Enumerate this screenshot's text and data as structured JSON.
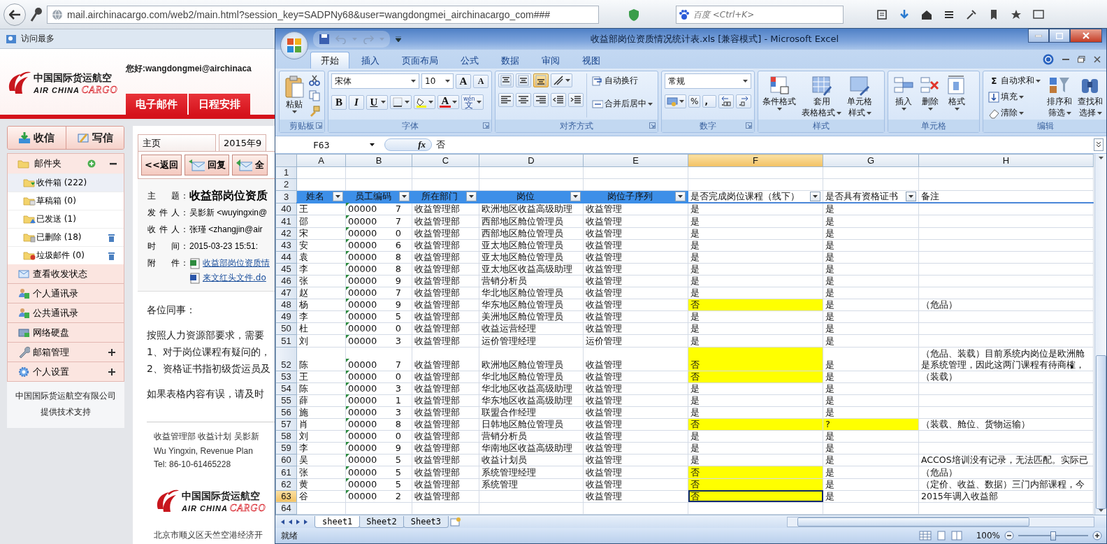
{
  "browser": {
    "url": "mail.airchinacargo.com/web2/main.html?session_key=SADPNy68&user=wangdongmei_airchinacargo_com###",
    "search_placeholder": "百度 <Ctrl+K>",
    "bookmarks": [
      "访问最多"
    ]
  },
  "mail": {
    "logo": {
      "name": "中国国际货运航空",
      "en": "AIR CHINA",
      "en_accent": "CARGO"
    },
    "greeting": "您好:wangdongmei@airchinaca",
    "nav": [
      "电子邮件",
      "日程安排"
    ],
    "actions": [
      {
        "label": "收信",
        "kind": "receive"
      },
      {
        "label": "写信",
        "kind": "compose"
      }
    ],
    "folders_title": "邮件夹",
    "folders": [
      {
        "label": "收件箱",
        "count": "(222)",
        "kind": "inbox",
        "selected": true
      },
      {
        "label": "草稿箱",
        "count": "(0)",
        "kind": "drafts",
        "selected": false
      },
      {
        "label": "已发送",
        "count": "(1)",
        "kind": "sent",
        "selected": false
      },
      {
        "label": "已删除",
        "count": "(18)",
        "kind": "deleted",
        "selected": false
      },
      {
        "label": "垃圾邮件",
        "count": "(0)",
        "kind": "spam",
        "selected": false
      }
    ],
    "menu": [
      {
        "label": "查看收发状态",
        "kind": "status",
        "expandable": false
      },
      {
        "label": "个人通讯录",
        "kind": "contacts",
        "expandable": false
      },
      {
        "label": "公共通讯录",
        "kind": "contacts",
        "expandable": false
      },
      {
        "label": "网络硬盘",
        "kind": "disk",
        "expandable": false
      },
      {
        "label": "邮箱管理",
        "kind": "admin",
        "expandable": true
      },
      {
        "label": "个人设置",
        "kind": "settings",
        "expandable": true
      }
    ],
    "footer": [
      "中国国际货运航空有限公司",
      "提供技术支持"
    ],
    "tabs": [
      "主页",
      "2015年9"
    ],
    "toolbar": [
      {
        "label": "<<返回",
        "kind": "back"
      },
      {
        "label": "回复",
        "kind": "reply"
      },
      {
        "label": "全",
        "kind": "reply_all"
      }
    ],
    "headers": [
      {
        "label": "主 题",
        "separator": "：",
        "value": "收益部岗位资质",
        "kind": "subject"
      },
      {
        "label": "发件人",
        "separator": "：",
        "value": "吴影新 <wuyingxin@",
        "kind": "plain"
      },
      {
        "label": "收件人",
        "separator": "：",
        "value": "张瑾 <zhangjin@air",
        "kind": "plain"
      },
      {
        "label": "时 间",
        "separator": "：",
        "value": "2015-03-23 15:51:",
        "kind": "plain"
      }
    ],
    "attachments_label": "附 件",
    "attachments_separator": "：",
    "attachments": [
      {
        "name": "收益部岗位资质情",
        "kind": "excel"
      },
      {
        "name": "来文红头文件.do",
        "kind": "word"
      }
    ],
    "body": [
      [
        "各位同事："
      ],
      [
        "按照人力资源部要求，需要",
        "1、对于岗位课程有疑问的，",
        "2、资格证书指初级货运员及"
      ],
      [
        "如果表格内容有误，请及时"
      ]
    ],
    "signature": [
      "收益管理部 收益计划 吴影新",
      "Wu Yingxin,  Revenue Plan",
      "Tel: 86-10-61465228"
    ],
    "signature_logo": {
      "name": "中国国际货运航空",
      "en": "AIR CHINA",
      "en_accent": "CARGO"
    },
    "address": "北京市顺义区天竺空港经济开"
  },
  "excel": {
    "title": "收益部岗位资质情况统计表.xls  [兼容模式] - Microsoft Excel",
    "tabs": [
      {
        "label": "开始",
        "selected": true
      },
      {
        "label": "插入",
        "selected": false
      },
      {
        "label": "页面布局",
        "selected": false
      },
      {
        "label": "公式",
        "selected": false
      },
      {
        "label": "数据",
        "selected": false
      },
      {
        "label": "审阅",
        "selected": false
      },
      {
        "label": "视图",
        "selected": false
      }
    ],
    "ribbon": [
      {
        "kind": "clipboard",
        "label": "剪贴板",
        "paste": "粘贴"
      },
      {
        "kind": "font",
        "label": "字体",
        "font": "宋体",
        "size": "10",
        "grow": "A",
        "shrink": "A",
        "bold": "B",
        "italic": "I",
        "underline": "U",
        "font_color_glyph": "A",
        "phonetic": "文",
        "phonetic_ruby": "wén"
      },
      {
        "kind": "alignment",
        "label": "对齐方式",
        "valign": [
          {
            "kind": "top",
            "selected": false
          },
          {
            "kind": "middle",
            "selected": false
          },
          {
            "kind": "bottom",
            "selected": true
          }
        ],
        "wrap": "自动换行",
        "merge": "合并后居中"
      },
      {
        "kind": "number",
        "label": "数字",
        "format": "常规",
        "percent": "%",
        "comma": ","
      },
      {
        "kind": "styles",
        "label": "样式",
        "buttons": [
          {
            "lines": [
              "条件格式"
            ],
            "kind": "conditional"
          },
          {
            "lines": [
              "套用",
              "表格格式"
            ],
            "kind": "table"
          },
          {
            "lines": [
              "单元格",
              "样式"
            ],
            "kind": "cellstyle"
          }
        ]
      },
      {
        "kind": "cells",
        "label": "单元格",
        "buttons": [
          {
            "lines": [
              "插入"
            ],
            "kind": "insert"
          },
          {
            "lines": [
              "删除"
            ],
            "kind": "delete"
          },
          {
            "lines": [
              "格式"
            ],
            "kind": "format"
          }
        ]
      },
      {
        "kind": "editing",
        "label": "编辑",
        "small": [
          {
            "label": "自动求和",
            "glyph": "Σ"
          },
          {
            "label": "填充",
            "kind": "fill"
          },
          {
            "label": "清除",
            "kind": "clear"
          }
        ],
        "buttons": [
          {
            "lines": [
              "排序和",
              "筛选"
            ],
            "kind": "sort"
          },
          {
            "lines": [
              "查找和",
              "选择"
            ],
            "kind": "find"
          }
        ]
      }
    ],
    "name_box": "F63",
    "function_label": "fx",
    "formula": "否",
    "columns": [
      {
        "letter": "A",
        "selected": false
      },
      {
        "letter": "B",
        "selected": false
      },
      {
        "letter": "C",
        "selected": false
      },
      {
        "letter": "D",
        "selected": false
      },
      {
        "letter": "E",
        "selected": false
      },
      {
        "letter": "F",
        "selected": true
      },
      {
        "letter": "G",
        "selected": false
      },
      {
        "letter": "H",
        "selected": false
      }
    ],
    "top_rows": [
      "1",
      "2"
    ],
    "header": {
      "row": "3",
      "cells": [
        {
          "label": "姓名",
          "filter": true,
          "fill": true
        },
        {
          "label": "员工编码",
          "filter": true,
          "fill": true
        },
        {
          "label": "所在部门",
          "filter": true,
          "fill": true
        },
        {
          "label": "岗位",
          "filter": true,
          "fill": true
        },
        {
          "label": "岗位子序列",
          "filter": true,
          "fill": true
        },
        {
          "label": "是否完成岗位课程（线下）",
          "filter": true,
          "fill": false
        },
        {
          "label": "是否具有资格证书",
          "filter": true,
          "fill": false
        },
        {
          "label": "备注",
          "filter": false,
          "fill": false
        }
      ]
    },
    "rows": [
      {
        "row": "40",
        "name": "王",
        "code_start": "00000",
        "code_end": "7",
        "dept": "收益管理部",
        "position": "欧洲地区收益高级助理",
        "sequence": "收益管理",
        "course": "是",
        "course_highlight": false,
        "cert": "是",
        "cert_highlight": false,
        "tall": false,
        "selected": false
      },
      {
        "row": "41",
        "name": "邵",
        "code_start": "00000",
        "code_end": "7",
        "dept": "收益管理部",
        "position": "西部地区舱位管理员",
        "sequence": "收益管理",
        "course": "是",
        "course_highlight": false,
        "cert": "是",
        "cert_highlight": false,
        "tall": false,
        "selected": false
      },
      {
        "row": "42",
        "name": "宋",
        "code_start": "00000",
        "code_end": "0",
        "dept": "收益管理部",
        "position": "西部地区舱位管理员",
        "sequence": "收益管理",
        "course": "是",
        "course_highlight": false,
        "cert": "是",
        "cert_highlight": false,
        "tall": false,
        "selected": false
      },
      {
        "row": "43",
        "name": "安",
        "code_start": "00000",
        "code_end": "6",
        "dept": "收益管理部",
        "position": "亚太地区舱位管理员",
        "sequence": "收益管理",
        "course": "是",
        "course_highlight": false,
        "cert": "是",
        "cert_highlight": false,
        "tall": false,
        "selected": false
      },
      {
        "row": "44",
        "name": "袁",
        "code_start": "00000",
        "code_end": "8",
        "dept": "收益管理部",
        "position": "亚太地区舱位管理员",
        "sequence": "收益管理",
        "course": "是",
        "course_highlight": false,
        "cert": "是",
        "cert_highlight": false,
        "tall": false,
        "selected": false
      },
      {
        "row": "45",
        "name": "李",
        "code_start": "00000",
        "code_end": "8",
        "dept": "收益管理部",
        "position": "亚太地区收益高级助理",
        "sequence": "收益管理",
        "course": "是",
        "course_highlight": false,
        "cert": "是",
        "cert_highlight": false,
        "tall": false,
        "selected": false
      },
      {
        "row": "46",
        "name": "张",
        "code_start": "00000",
        "code_end": "9",
        "dept": "收益管理部",
        "position": "营销分析员",
        "sequence": "收益管理",
        "course": "是",
        "course_highlight": false,
        "cert": "是",
        "cert_highlight": false,
        "tall": false,
        "selected": false
      },
      {
        "row": "47",
        "name": "赵",
        "code_start": "00000",
        "code_end": "7",
        "dept": "收益管理部",
        "position": "华北地区舱位管理员",
        "sequence": "收益管理",
        "course": "是",
        "course_highlight": false,
        "cert": "是",
        "cert_highlight": false,
        "tall": false,
        "selected": false
      },
      {
        "row": "48",
        "name": "杨",
        "code_start": "00000",
        "code_end": "9",
        "dept": "收益管理部",
        "position": "华东地区舱位管理员",
        "sequence": "收益管理",
        "course": "否",
        "course_highlight": true,
        "cert": "是",
        "cert_highlight": false,
        "notes": [
          "（危品）"
        ],
        "tall": false,
        "selected": false
      },
      {
        "row": "49",
        "name": "李",
        "code_start": "00000",
        "code_end": "5",
        "dept": "收益管理部",
        "position": "美洲地区舱位管理员",
        "sequence": "收益管理",
        "course": "是",
        "course_highlight": false,
        "cert": "是",
        "cert_highlight": false,
        "tall": false,
        "selected": false
      },
      {
        "row": "50",
        "name": "杜",
        "code_start": "00000",
        "code_end": "0",
        "dept": "收益管理部",
        "position": "收益运营经理",
        "sequence": "收益管理",
        "course": "是",
        "course_highlight": false,
        "cert": "是",
        "cert_highlight": false,
        "tall": false,
        "selected": false
      },
      {
        "row": "51",
        "name": "刘",
        "code_start": "00000",
        "code_end": "3",
        "dept": "收益管理部",
        "position": "运价管理经理",
        "sequence": "运价管理",
        "course": "是",
        "course_highlight": false,
        "cert": "是",
        "cert_highlight": false,
        "tall": false,
        "selected": false
      },
      {
        "row": "52",
        "name": "陈",
        "code_start": "00000",
        "code_end": "7",
        "dept": "收益管理部",
        "position": "欧洲地区舱位管理员",
        "sequence": "收益管理",
        "course": "否",
        "course_highlight": true,
        "cert": "是",
        "cert_highlight": false,
        "notes": [
          "（危品、装载）目前系统内岗位是欧洲舱",
          "是系统管理，因此这两门课程有待商榷，"
        ],
        "tall": true,
        "selected": false
      },
      {
        "row": "53",
        "name": "王",
        "code_start": "00000",
        "code_end": "0",
        "dept": "收益管理部",
        "position": "华北地区舱位管理员",
        "sequence": "收益管理",
        "course": "否",
        "course_highlight": true,
        "cert": "是",
        "cert_highlight": false,
        "notes": [
          "（装载）"
        ],
        "tall": false,
        "selected": false
      },
      {
        "row": "54",
        "name": "陈",
        "code_start": "00000",
        "code_end": "3",
        "dept": "收益管理部",
        "position": "华北地区收益高级助理",
        "sequence": "收益管理",
        "course": "是",
        "course_highlight": false,
        "cert": "是",
        "cert_highlight": false,
        "tall": false,
        "selected": false
      },
      {
        "row": "55",
        "name": "薛",
        "code_start": "00000",
        "code_end": "1",
        "dept": "收益管理部",
        "position": "华东地区收益高级助理",
        "sequence": "收益管理",
        "course": "是",
        "course_highlight": false,
        "cert": "是",
        "cert_highlight": false,
        "tall": false,
        "selected": false
      },
      {
        "row": "56",
        "name": "施",
        "code_start": "00000",
        "code_end": "3",
        "dept": "收益管理部",
        "position": "联盟合作经理",
        "sequence": "收益管理",
        "course": "是",
        "course_highlight": false,
        "cert": "是",
        "cert_highlight": false,
        "tall": false,
        "selected": false
      },
      {
        "row": "57",
        "name": "肖",
        "code_start": "00000",
        "code_end": "8",
        "dept": "收益管理部",
        "position": "日韩地区舱位管理员",
        "sequence": "收益管理",
        "course": "否",
        "course_highlight": true,
        "cert": "?",
        "cert_highlight": true,
        "notes": [
          "（装载、舱位、货物运输）"
        ],
        "tall": false,
        "selected": false
      },
      {
        "row": "58",
        "name": "刘",
        "code_start": "00000",
        "code_end": "0",
        "dept": "收益管理部",
        "position": "营销分析员",
        "sequence": "收益管理",
        "course": "是",
        "course_highlight": false,
        "cert": "是",
        "cert_highlight": false,
        "tall": false,
        "selected": false
      },
      {
        "row": "59",
        "name": "李",
        "code_start": "00000",
        "code_end": "9",
        "dept": "收益管理部",
        "position": "华南地区收益高级助理",
        "sequence": "收益管理",
        "course": "是",
        "course_highlight": false,
        "cert": "是",
        "cert_highlight": false,
        "tall": false,
        "selected": false
      },
      {
        "row": "60",
        "name": "吴",
        "code_start": "00000",
        "code_end": "5",
        "dept": "收益管理部",
        "position": "收益计划员",
        "sequence": "收益管理",
        "course": "是",
        "course_highlight": false,
        "cert": "是",
        "cert_highlight": false,
        "notes": [
          "ACCOS培训没有记录，无法匹配。实际已"
        ],
        "tall": false,
        "selected": false
      },
      {
        "row": "61",
        "name": "张",
        "code_start": "00000",
        "code_end": "5",
        "dept": "收益管理部",
        "position": "系统管理经理",
        "sequence": "收益管理",
        "course": "否",
        "course_highlight": true,
        "cert": "是",
        "cert_highlight": false,
        "notes": [
          "（危品）"
        ],
        "tall": false,
        "selected": false
      },
      {
        "row": "62",
        "name": "黄",
        "code_start": "00000",
        "code_end": "5",
        "dept": "收益管理部",
        "position": "系统管理",
        "sequence": "收益管理",
        "course": "否",
        "course_highlight": true,
        "cert": "是",
        "cert_highlight": false,
        "notes": [
          "（定价、收益、数据）三门内部课程，今"
        ],
        "tall": false,
        "selected": false
      },
      {
        "row": "63",
        "name": "谷",
        "code_start": "00000",
        "code_end": "2",
        "dept": "收益管理部",
        "sequence": "收益管理",
        "course": "否",
        "course_highlight": true,
        "cert": "是",
        "cert_highlight": false,
        "notes": [
          "2015年调入收益部"
        ],
        "tall": false,
        "selected": true
      }
    ],
    "bottom_rows": [
      "64"
    ],
    "sheets": [
      {
        "label": "sheet1",
        "selected": true
      },
      {
        "label": "Sheet2",
        "selected": false
      },
      {
        "label": "Sheet3",
        "selected": false
      }
    ],
    "status": "就绪",
    "zoom": {
      "reading": "100%",
      "level": 0.5
    }
  }
}
